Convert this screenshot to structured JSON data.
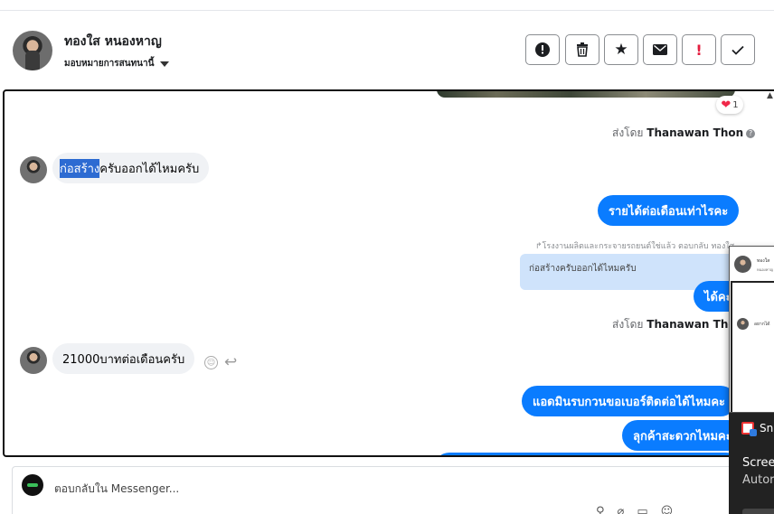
{
  "header": {
    "contact_name": "ทองใส หนองหาญ",
    "assign_label": "มอบหมายการสนทนานี้",
    "toolbar": [
      {
        "name": "mark-spam-button",
        "icon": "alert-circle-icon",
        "glyph": "!"
      },
      {
        "name": "delete-button",
        "icon": "trash-icon",
        "glyph": "🗑"
      },
      {
        "name": "star-button",
        "icon": "star-icon",
        "glyph": "★"
      },
      {
        "name": "mark-unread-button",
        "icon": "envelope-icon",
        "glyph": "✉"
      },
      {
        "name": "flag-important-button",
        "icon": "exclamation-icon",
        "glyph": "!"
      },
      {
        "name": "mark-done-button",
        "icon": "check-icon",
        "glyph": "✓"
      }
    ]
  },
  "conversation": {
    "reaction_count": "1",
    "sent_by_prefix": "ส่งโดย",
    "sent_by_name_1": "Thanawan Thon",
    "sent_by_name_2": "Thanawan Thon",
    "msg1_selected": "ก่อสร้าง",
    "msg1_rest": "ครับออกได้ไหมครับ",
    "msg2": "รายได้ต่อเดือนเท่าไรคะ",
    "reply_note": "โรงงานผลิตและกระจายรถยนต์ใช่แล้ว ตอบกลับ ทองใส",
    "quoted_text": "ก่อสร้างครับออกได้ไหมครับ",
    "msg3": "ได้คะ",
    "msg4": "21000บาทต่อเดือนครับ",
    "msg5": "แอดมินรบกวนขอเบอร์ติดต่อได้ไหมคะ",
    "msg6": "ลุกค้าสะดวกไหมคะ"
  },
  "composer": {
    "placeholder": "ตอบกลับใน Messenger..."
  },
  "floating_chat": {
    "name": "ทองใส",
    "subtitle": "หนองหาญ",
    "message": "อยากได้"
  },
  "notification": {
    "app": "Sn",
    "line1": "Scree",
    "line2": "Autor"
  },
  "colors": {
    "outgoing": "#0a7cff",
    "incoming": "#f0f2f5",
    "selection": "#2d6bd2",
    "quote": "#cfe3fb"
  }
}
